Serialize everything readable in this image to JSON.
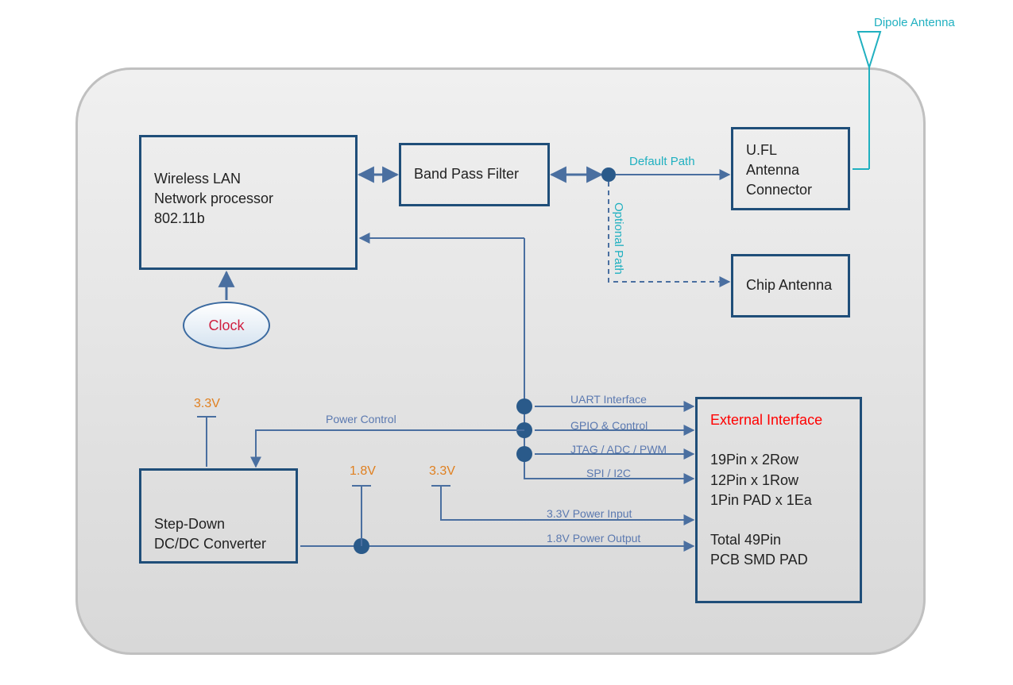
{
  "dipole_label": "Dipole Antenna",
  "blocks": {
    "wlan": "Wireless LAN\nNetwork processor\n802.11b",
    "bpf": "Band Pass Filter",
    "ufl": "U.FL\nAntenna\nConnector",
    "chip": "Chip Antenna",
    "clock": "Clock",
    "dcdc": "Step-Down\nDC/DC Converter",
    "ext_title": "External Interface",
    "ext_body": "19Pin x 2Row\n12Pin x 1Row\n1Pin PAD x 1Ea\n\nTotal 49Pin\nPCB SMD PAD"
  },
  "labels": {
    "default_path": "Default Path",
    "optional_path": "Optional Path",
    "uart": "UART Interface",
    "gpio": "GPIO & Control",
    "jtag": "JTAG / ADC / PWM",
    "spi": "SPI / I2C",
    "power_control": "Power Control",
    "v33a": "3.3V",
    "v18": "1.8V",
    "v33b": "3.3V",
    "v33_input": "3.3V Power Input",
    "v18_output": "1.8V Power Output"
  }
}
